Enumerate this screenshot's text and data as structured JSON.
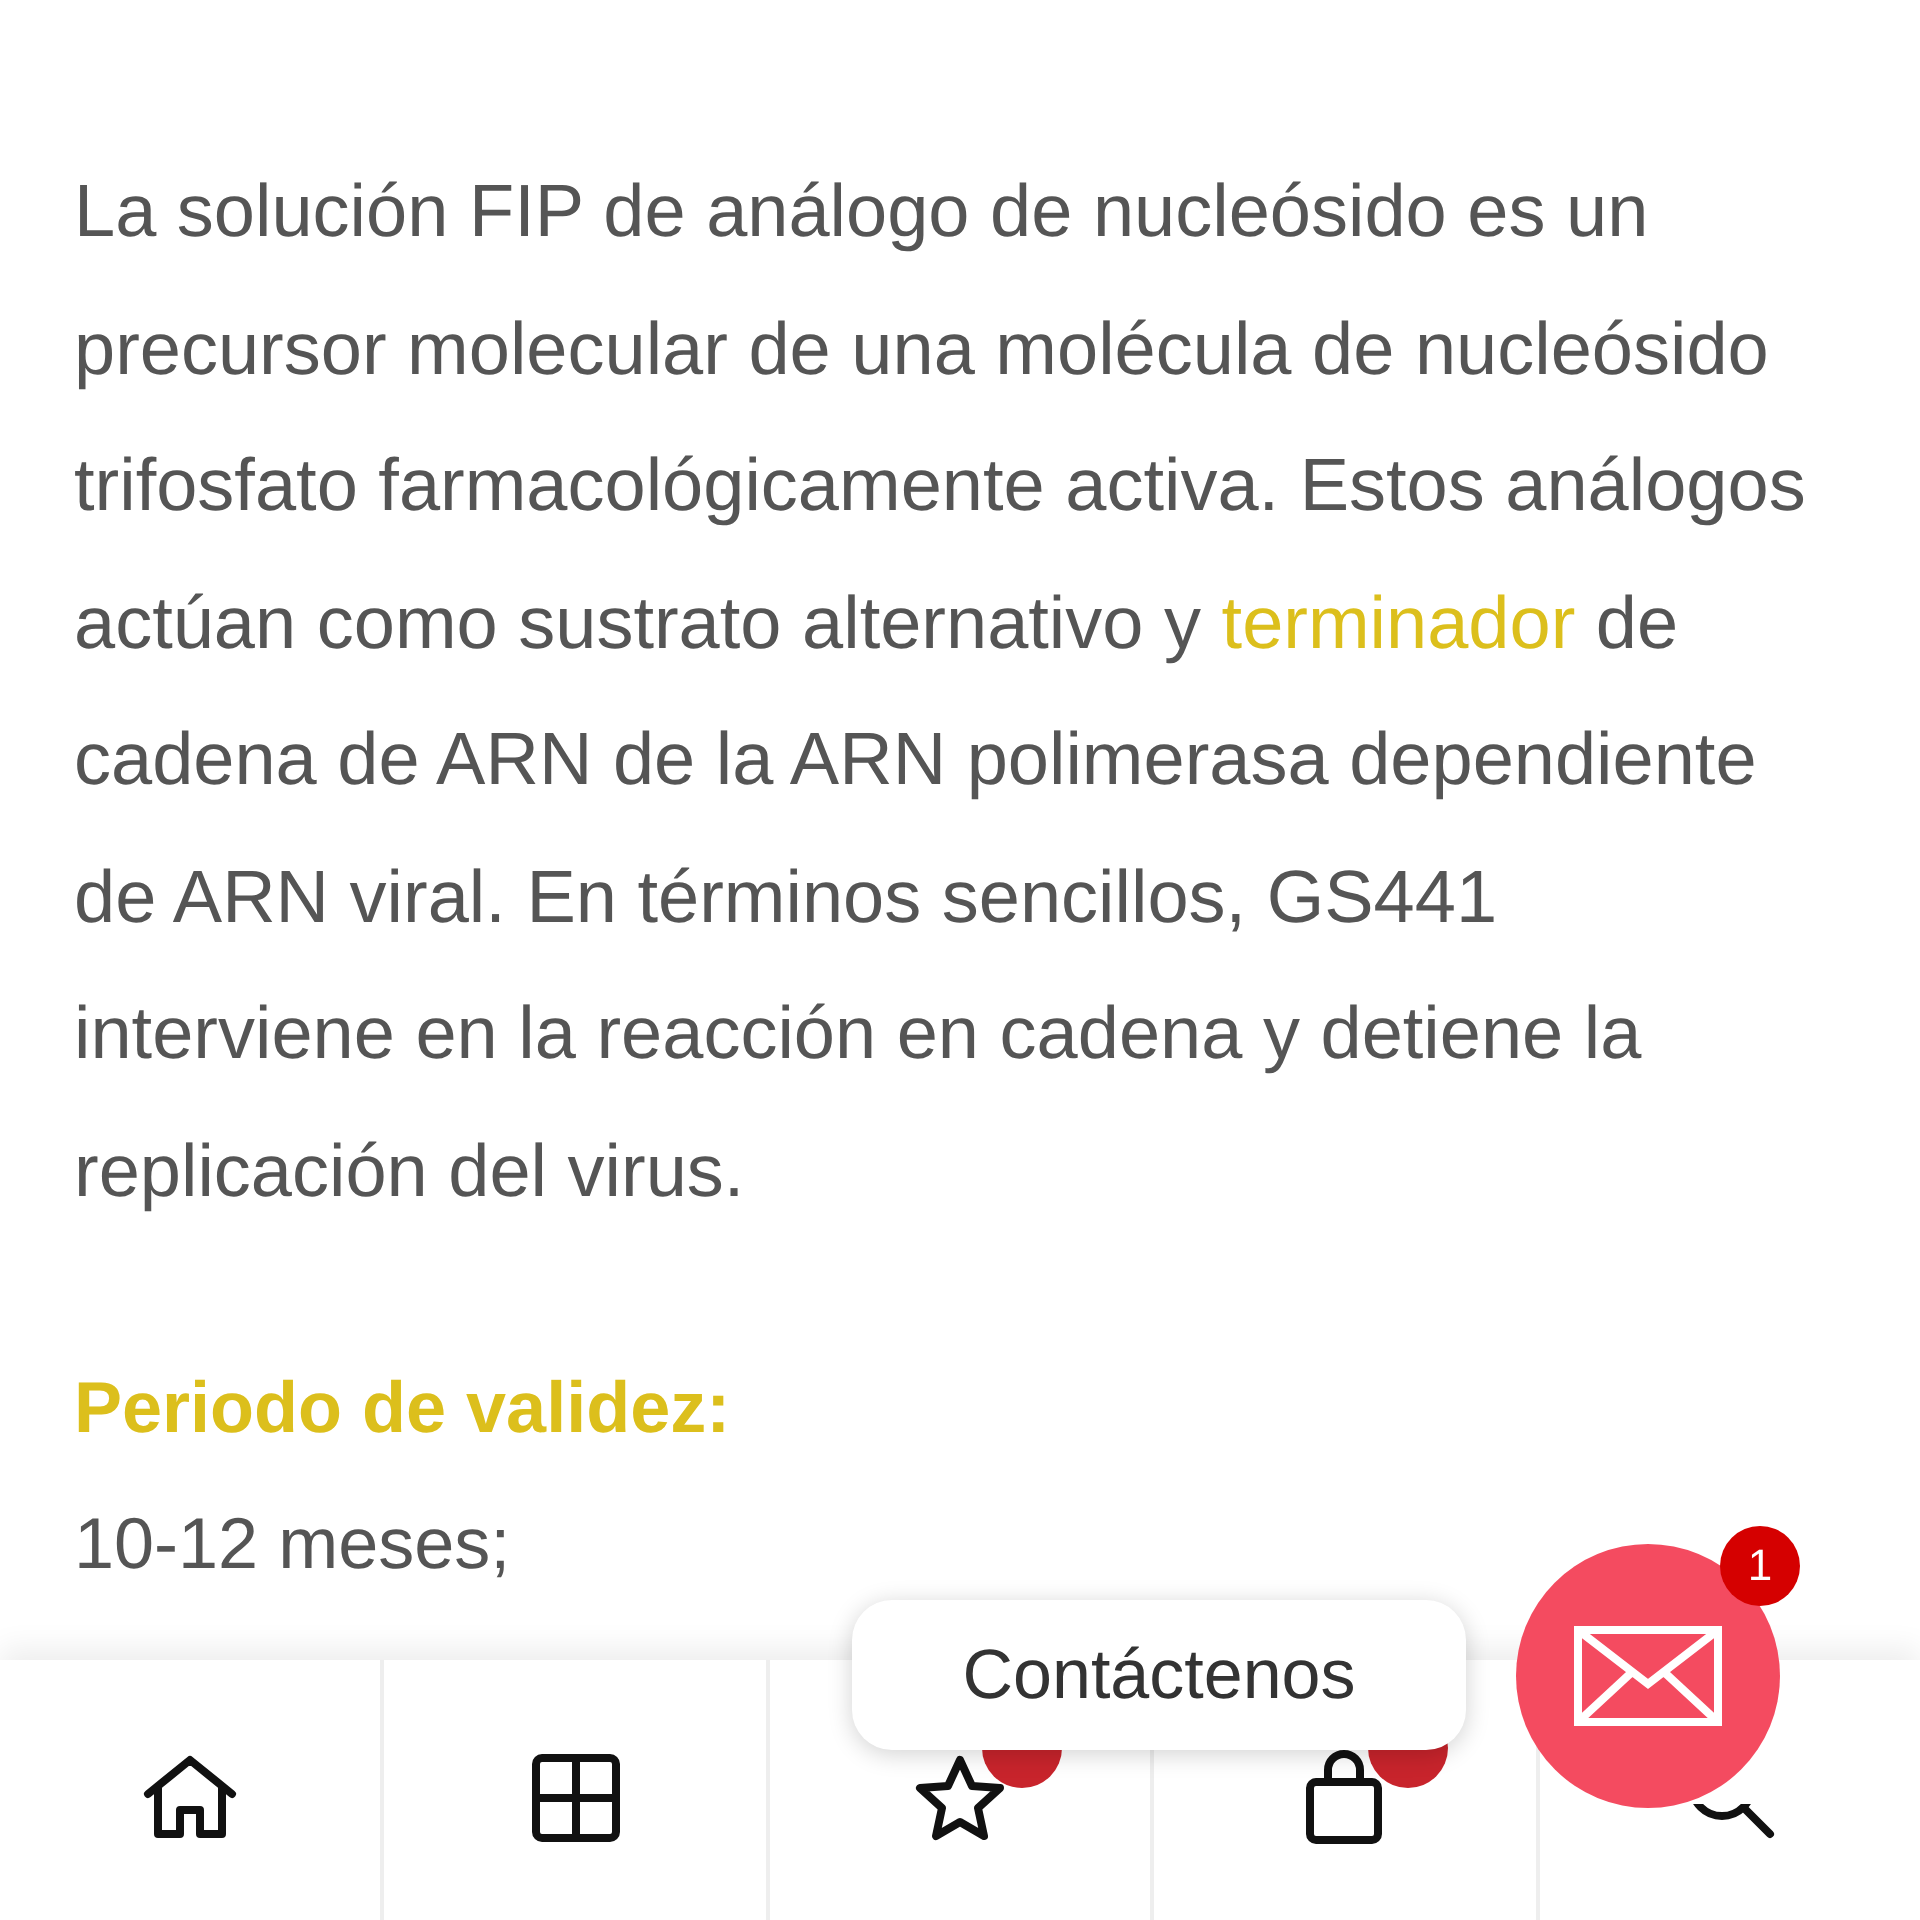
{
  "description": {
    "before": "La solución FIP de análogo de nucleósido es un precursor molecular de una molécula de nucleósido trifosfato farmacológicamente activa. Estos análogos actúan como sustrato alternativo y ",
    "link": "terminador",
    "after": " de cadena de ARN de la ARN polimerasa dependiente de ARN viral. En términos sencillos, GS441 interviene en la reacción en cadena y detiene la replicación del virus."
  },
  "validity": {
    "heading": "Periodo de validez:",
    "value": "10-12 meses;"
  },
  "bottom_nav": [
    {
      "kind": "home",
      "has_badge": false
    },
    {
      "kind": "categories",
      "has_badge": false
    },
    {
      "kind": "wishlist",
      "has_badge": true
    },
    {
      "kind": "cart",
      "has_badge": true
    },
    {
      "kind": "search",
      "has_badge": false
    }
  ],
  "contact": {
    "label": "Contáctenos",
    "badge": "1"
  }
}
